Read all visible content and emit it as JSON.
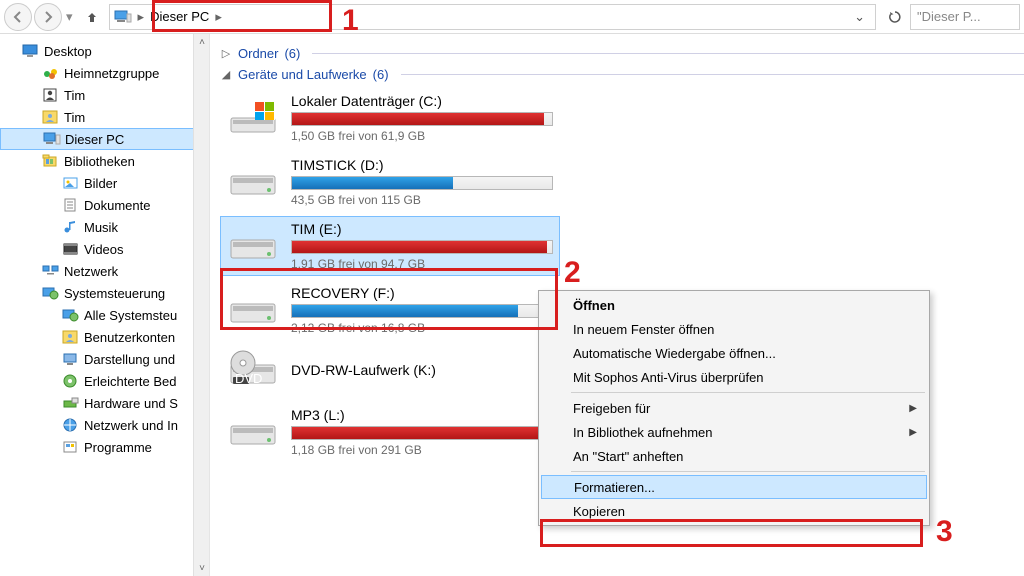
{
  "breadcrumb": {
    "root_label": "Dieser PC"
  },
  "search": {
    "placeholder": "\"Dieser P..."
  },
  "tree": [
    {
      "label": "Desktop",
      "lvl": 0,
      "icon": "monitor",
      "sel": false
    },
    {
      "label": "Heimnetzgruppe",
      "lvl": 1,
      "icon": "homegroup",
      "sel": false
    },
    {
      "label": "Tim",
      "lvl": 1,
      "icon": "user-bw",
      "sel": false
    },
    {
      "label": "Tim",
      "lvl": 1,
      "icon": "user",
      "sel": false
    },
    {
      "label": "Dieser PC",
      "lvl": 1,
      "icon": "pc",
      "sel": true
    },
    {
      "label": "Bibliotheken",
      "lvl": 1,
      "icon": "libs",
      "sel": false
    },
    {
      "label": "Bilder",
      "lvl": 2,
      "icon": "pictures",
      "sel": false
    },
    {
      "label": "Dokumente",
      "lvl": 2,
      "icon": "docs",
      "sel": false
    },
    {
      "label": "Musik",
      "lvl": 2,
      "icon": "music",
      "sel": false
    },
    {
      "label": "Videos",
      "lvl": 2,
      "icon": "videos",
      "sel": false
    },
    {
      "label": "Netzwerk",
      "lvl": 1,
      "icon": "network",
      "sel": false
    },
    {
      "label": "Systemsteuerung",
      "lvl": 1,
      "icon": "control",
      "sel": false
    },
    {
      "label": "Alle Systemsteu",
      "lvl": 2,
      "icon": "control",
      "sel": false
    },
    {
      "label": "Benutzerkonten",
      "lvl": 2,
      "icon": "user",
      "sel": false
    },
    {
      "label": "Darstellung und",
      "lvl": 2,
      "icon": "display",
      "sel": false
    },
    {
      "label": "Erleichterte Bed",
      "lvl": 2,
      "icon": "ease",
      "sel": false
    },
    {
      "label": "Hardware und S",
      "lvl": 2,
      "icon": "hardware",
      "sel": false
    },
    {
      "label": "Netzwerk und In",
      "lvl": 2,
      "icon": "netint",
      "sel": false
    },
    {
      "label": "Programme",
      "lvl": 2,
      "icon": "programs",
      "sel": false
    }
  ],
  "groups": {
    "folders": {
      "label": "Ordner",
      "count": "(6)",
      "expanded": false
    },
    "devices": {
      "label": "Geräte und Laufwerke",
      "count": "(6)",
      "expanded": true
    }
  },
  "drives": [
    {
      "name": "Lokaler Datenträger (C:)",
      "free": "1,50 GB frei von 61,9 GB",
      "fill": 97,
      "color": "red",
      "icon": "osdisk",
      "sel": false
    },
    {
      "name": "TIMSTICK (D:)",
      "free": "43,5 GB frei von 115 GB",
      "fill": 62,
      "color": "blue",
      "icon": "hdd",
      "sel": false
    },
    {
      "name": "TIM (E:)",
      "free": "1,91 GB frei von 94,7 GB",
      "fill": 98,
      "color": "red",
      "icon": "hdd",
      "sel": true
    },
    {
      "name": "RECOVERY (F:)",
      "free": "2,12 GB frei von 16,8 GB",
      "fill": 87,
      "color": "blue",
      "icon": "hdd",
      "sel": false
    },
    {
      "name": "DVD-RW-Laufwerk (K:)",
      "free": "",
      "fill": 0,
      "color": "",
      "icon": "dvd",
      "sel": false
    },
    {
      "name": "MP3 (L:)",
      "free": "1,18 GB frei von 291 GB",
      "fill": 99,
      "color": "red",
      "icon": "hdd",
      "sel": false
    }
  ],
  "context": [
    {
      "label": "Öffnen",
      "bold": true
    },
    {
      "label": "In neuem Fenster öffnen"
    },
    {
      "label": "Automatische Wiedergabe öffnen..."
    },
    {
      "label": "Mit Sophos Anti-Virus überprüfen"
    },
    {
      "sep": true
    },
    {
      "label": "Freigeben für",
      "sub": true
    },
    {
      "label": "In Bibliothek aufnehmen",
      "sub": true
    },
    {
      "label": "An \"Start\" anheften"
    },
    {
      "sep": true
    },
    {
      "label": "Formatieren...",
      "hl": true
    },
    {
      "label": "Kopieren"
    }
  ],
  "annotations": {
    "n1": "1",
    "n2": "2",
    "n3": "3"
  }
}
